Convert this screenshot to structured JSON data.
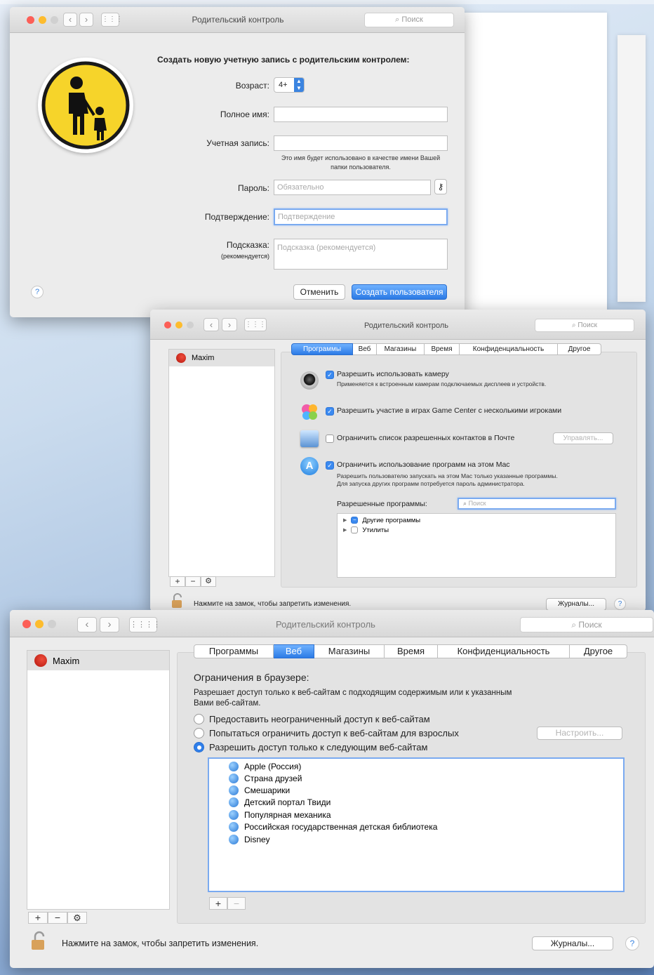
{
  "window1": {
    "title": "Родительский контроль",
    "search_placeholder": "Поиск",
    "heading": "Создать новую учетную запись с родительским контролем:",
    "age_label": "Возраст:",
    "age_value": "4+",
    "fullname_label": "Полное имя:",
    "account_label": "Учетная запись:",
    "account_hint_line1": "Это имя будет использовано в качестве имени Вашей",
    "account_hint_line2": "папки пользователя.",
    "password_label": "Пароль:",
    "password_placeholder": "Обязательно",
    "confirm_label": "Подтверждение:",
    "confirm_placeholder": "Подтверждение",
    "hint_label": "Подсказка:",
    "hint_label_sub": "(рекомендуется)",
    "hint_placeholder": "Подсказка (рекомендуется)",
    "cancel_button": "Отменить",
    "create_button": "Создать пользователя",
    "help": "?"
  },
  "window2": {
    "title": "Родительский контроль",
    "search_placeholder": "Поиск",
    "user": "Maxim",
    "tabs": [
      "Программы",
      "Веб",
      "Магазины",
      "Время",
      "Конфиденциальность",
      "Другое"
    ],
    "selected_tab": "Программы",
    "camera_label": "Разрешить использовать камеру",
    "camera_sub": "Применяется к встроенным камерам подключаемых дисплеев и устройств.",
    "gamecenter_label": "Разрешить участие в играх Game Center с несколькими игроками",
    "mail_label": "Ограничить список разрешенных контактов в Почте",
    "manage_button": "Управлять...",
    "limit_apps_label": "Ограничить использование программ на этом Mac",
    "limit_apps_sub1": "Разрешить пользователю запускать на этом Mac только указанные программы.",
    "limit_apps_sub2": "Для запуска других программ потребуется пароль администратора.",
    "allowed_label": "Разрешенные программы:",
    "allowed_search": "Поиск",
    "apps": [
      "Другие программы",
      "Утилиты"
    ],
    "lock_text": "Нажмите на замок, чтобы запретить изменения.",
    "logs_button": "Журналы...",
    "help": "?"
  },
  "window3": {
    "title": "Родительский контроль",
    "search_placeholder": "Поиск",
    "user": "Maxim",
    "tabs": [
      "Программы",
      "Веб",
      "Магазины",
      "Время",
      "Конфиденциальность",
      "Другое"
    ],
    "selected_tab": "Веб",
    "section_title": "Ограничения в браузере:",
    "desc_line1": "Разрешает доступ только к веб-сайтам с подходящим содержимым или к указанным",
    "desc_line2": "Вами веб-сайтам.",
    "opt_unrestricted": "Предоставить неограниченный доступ к веб-сайтам",
    "opt_adult": "Попытаться ограничить доступ к веб-сайтам для взрослых",
    "configure_button": "Настроить...",
    "opt_only": "Разрешить доступ только к следующим веб-сайтам",
    "sites": [
      "Apple (Россия)",
      "Страна друзей",
      "Смешарики",
      "Детский портал Твиди",
      "Популярная механика",
      "Российская государственная детская библиотека",
      "Disney"
    ],
    "lock_text": "Нажмите на замок, чтобы запретить изменения.",
    "logs_button": "Журналы...",
    "help": "?"
  },
  "colors": {
    "accent": "#2c7be6",
    "close": "#fc5f57",
    "minimize": "#fdbc2e",
    "zoom_disabled": "#d0d0d0",
    "parental_icon": "#f6d42a"
  }
}
